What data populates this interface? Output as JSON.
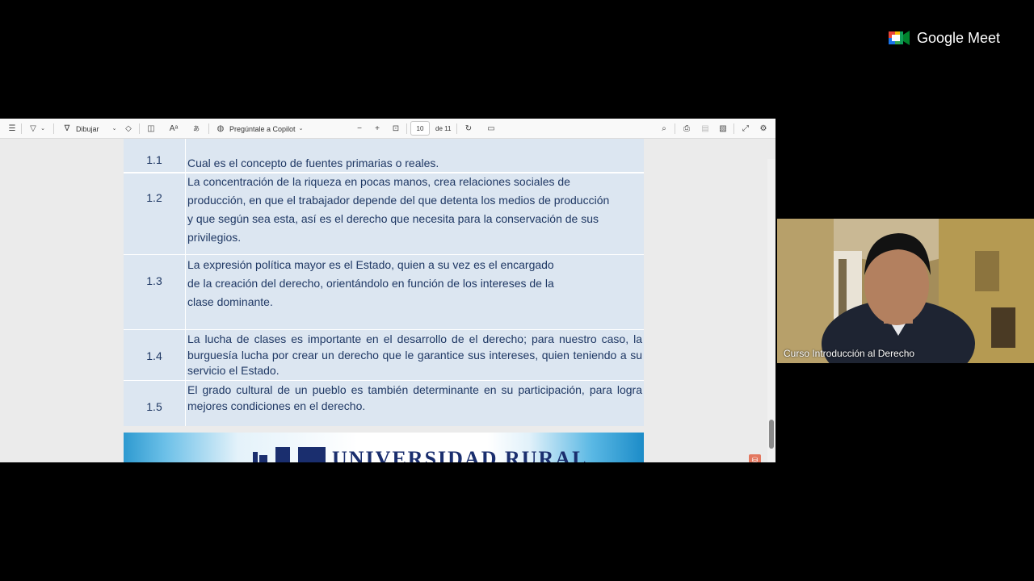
{
  "toolbar": {
    "draw_label": "Dibujar",
    "copilot_label": "Pregúntale a Copilot",
    "page_current": "10",
    "page_total": "de 11"
  },
  "table": {
    "rows": [
      {
        "num": "1.1",
        "text": "Cual es el concepto de fuentes primarias o reales."
      },
      {
        "num": "1.2",
        "lines": [
          "La concentración de la riqueza en pocas manos, crea relaciones sociales de",
          "producción, en que el trabajador depende del que detenta los medios de producción",
          "y que según sea esta, así es el derecho que necesita para la conservación de sus",
          "privilegios."
        ]
      },
      {
        "num": "1.3",
        "lines": [
          "La expresión política mayor es el Estado, quien a su vez es el encargado",
          "de la creación del derecho, orientándolo en función de los intereses de la",
          "clase dominante."
        ]
      },
      {
        "num": "1.4",
        "text": "La lucha de clases es importante en el desarrollo de el derecho; para nuestro caso, la burguesía lucha por crear un derecho que le garantice sus intereses, quien teniendo a su servicio el Estado."
      },
      {
        "num": "1.5",
        "text": "El grado cultural de un pueblo es también determinante en su participación, para logra mejores condiciones en el derecho."
      }
    ]
  },
  "banner": {
    "text": "UNIVERSIDAD RURAL"
  },
  "meet": {
    "brand": "Google Meet",
    "participant_name": "Curso Introducción al Derecho"
  }
}
